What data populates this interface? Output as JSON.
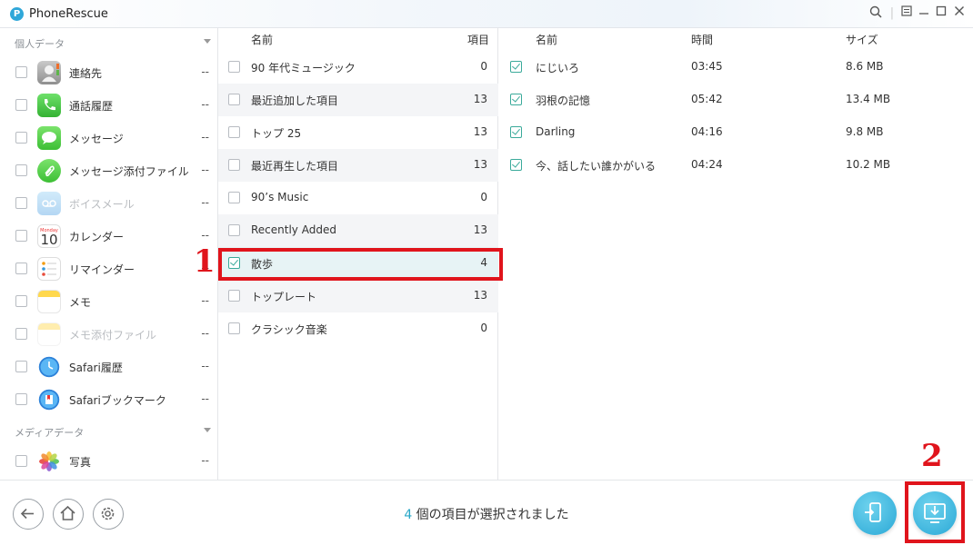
{
  "app": {
    "title": "PhoneRescue"
  },
  "sidebar": {
    "section_personal": "個人データ",
    "section_media": "メディアデータ",
    "items": [
      {
        "label": "連絡先",
        "count": "--",
        "icon": "contacts-icon",
        "disabled": false
      },
      {
        "label": "通話履歴",
        "count": "--",
        "icon": "phone-icon",
        "disabled": false
      },
      {
        "label": "メッセージ",
        "count": "--",
        "icon": "messages-icon",
        "disabled": false
      },
      {
        "label": "メッセージ添付ファイル",
        "count": "--",
        "icon": "attachment-icon",
        "disabled": false
      },
      {
        "label": "ボイスメール",
        "count": "--",
        "icon": "voicemail-icon",
        "disabled": true
      },
      {
        "label": "カレンダー",
        "count": "--",
        "icon": "calendar-icon",
        "disabled": false
      },
      {
        "label": "リマインダー",
        "count": "--",
        "icon": "reminders-icon",
        "disabled": false
      },
      {
        "label": "メモ",
        "count": "--",
        "icon": "notes-icon",
        "disabled": false
      },
      {
        "label": "メモ添付ファイル",
        "count": "--",
        "icon": "notes-attachment-icon",
        "disabled": true
      },
      {
        "label": "Safari履歴",
        "count": "--",
        "icon": "safari-history-icon",
        "disabled": false
      },
      {
        "label": "Safariブックマーク",
        "count": "--",
        "icon": "safari-bookmark-icon",
        "disabled": false
      }
    ],
    "media_items": [
      {
        "label": "写真",
        "count": "--",
        "icon": "photos-icon"
      }
    ],
    "calendar_day": "10"
  },
  "playlists": {
    "header_name": "名前",
    "header_count": "項目",
    "rows": [
      {
        "name": "90 年代ミュージック",
        "count": "0",
        "checked": false
      },
      {
        "name": "最近追加した項目",
        "count": "13",
        "checked": false
      },
      {
        "name": "トップ 25",
        "count": "13",
        "checked": false
      },
      {
        "name": "最近再生した項目",
        "count": "13",
        "checked": false
      },
      {
        "name": "90’s Music",
        "count": "0",
        "checked": false
      },
      {
        "name": "Recently Added",
        "count": "13",
        "checked": false
      },
      {
        "name": "散歩",
        "count": "4",
        "checked": true,
        "selected": true
      },
      {
        "name": "トップレート",
        "count": "13",
        "checked": false
      },
      {
        "name": "クラシック音楽",
        "count": "0",
        "checked": false
      }
    ]
  },
  "songs": {
    "header_name": "名前",
    "header_time": "時間",
    "header_size": "サイズ",
    "rows": [
      {
        "name": "にじいろ",
        "time": "03:45",
        "size": "8.6 MB",
        "checked": true
      },
      {
        "name": "羽根の記憶",
        "time": "05:42",
        "size": "13.4 MB",
        "checked": true
      },
      {
        "name": "Darling",
        "time": "04:16",
        "size": "9.8 MB",
        "checked": true
      },
      {
        "name": "今、話したい誰かがいる",
        "time": "04:24",
        "size": "10.2 MB",
        "checked": true
      }
    ]
  },
  "status": {
    "count": "4",
    "text": " 個の項目が選択されました"
  },
  "annotations": {
    "step1": "1",
    "step2": "2"
  },
  "colors": {
    "accent": "#2aa8c8",
    "check": "#3aaa9a",
    "annotation": "#e0141c"
  }
}
